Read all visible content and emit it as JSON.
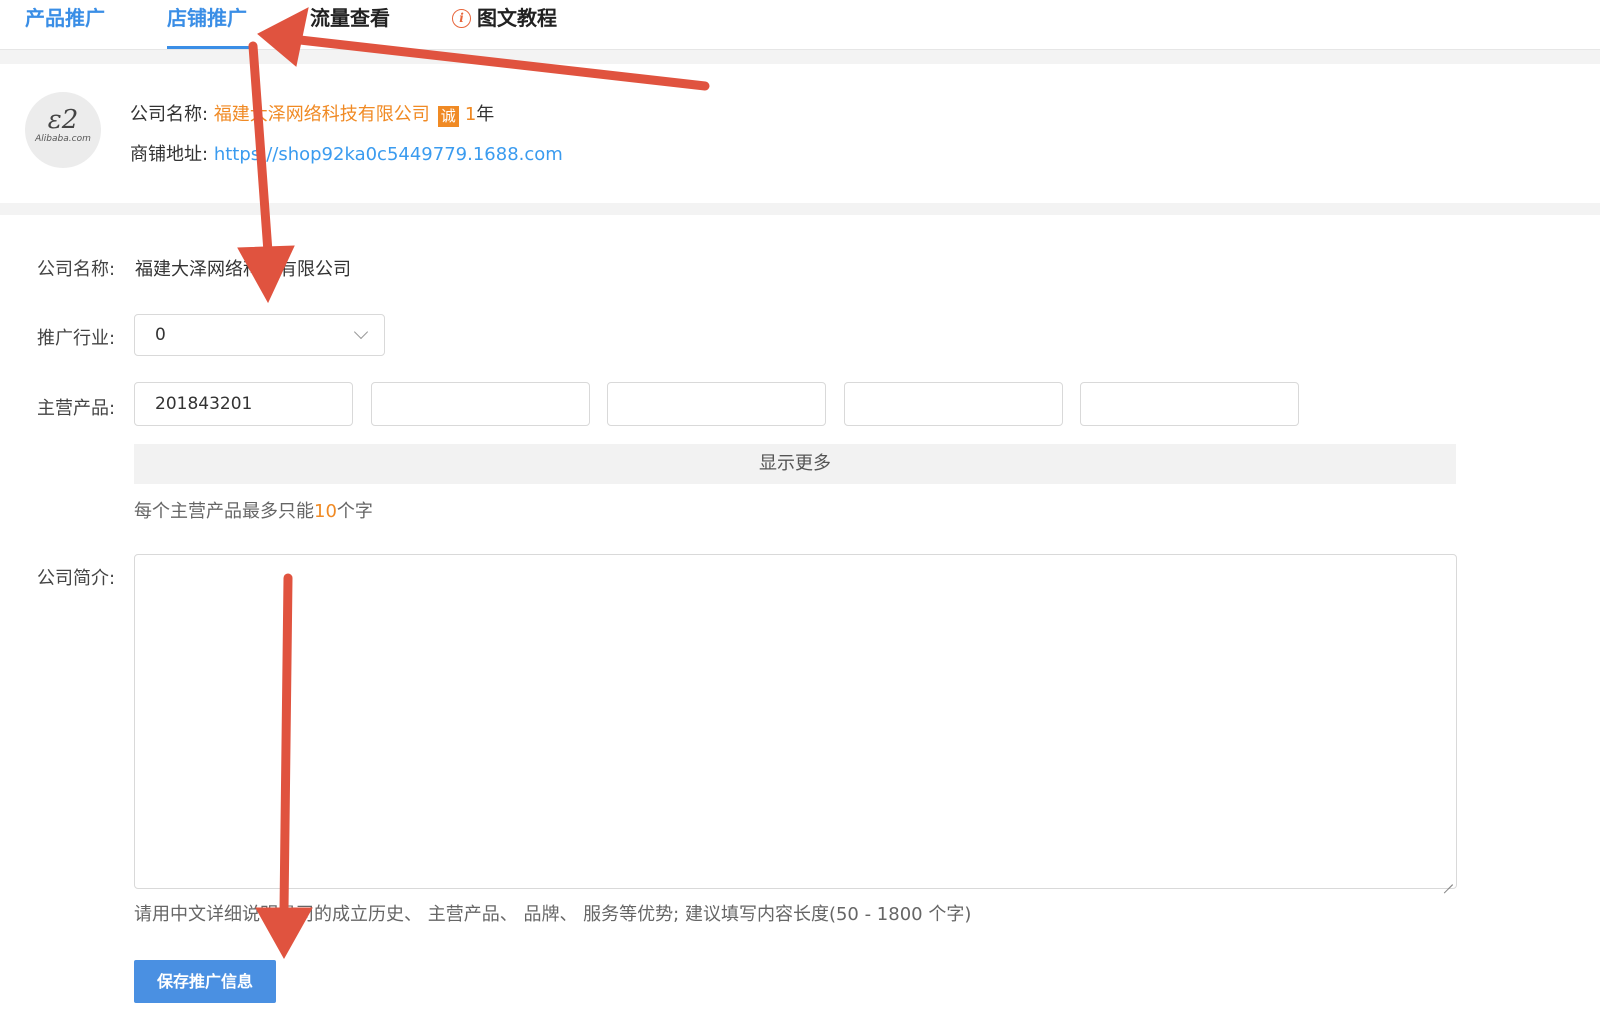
{
  "tabs": [
    {
      "label": "产品推广"
    },
    {
      "label": "店铺推广"
    },
    {
      "label": "流量查看"
    },
    {
      "label": "图文教程"
    }
  ],
  "header": {
    "logo_mark": "ɛ2",
    "logo_text": "Alibaba.com",
    "company_label": "公司名称:",
    "company_name": "福建大泽网络科技有限公司",
    "cheng_badge": "诚",
    "years_num": "1",
    "years_unit": "年",
    "store_label": "商铺地址:",
    "store_url": "https://shop92ka0c5449779.1688.com"
  },
  "form": {
    "company_label": "公司名称:",
    "company_value": "福建大泽网络科技有限公司",
    "industry_label": "推广行业:",
    "industry_value": "0",
    "products_label": "主营产品:",
    "products": [
      "201843201",
      "",
      "",
      "",
      ""
    ],
    "show_more": "显示更多",
    "product_hint_pre": "每个主营产品最多只能",
    "product_hint_num": "10",
    "product_hint_post": "个字",
    "intro_label": "公司简介:",
    "intro_value": "",
    "intro_hint": "请用中文详细说明贵司的成立历史、 主营产品、 品牌、 服务等优势;  建议填写内容长度(50 - 1800 个字)",
    "save_button": "保存推广信息"
  },
  "colors": {
    "accent_blue": "#3a8ee6",
    "orange": "#f08a24",
    "link": "#3a9bef",
    "arrow_red": "#e0533f",
    "button_blue": "#4a90e2"
  }
}
